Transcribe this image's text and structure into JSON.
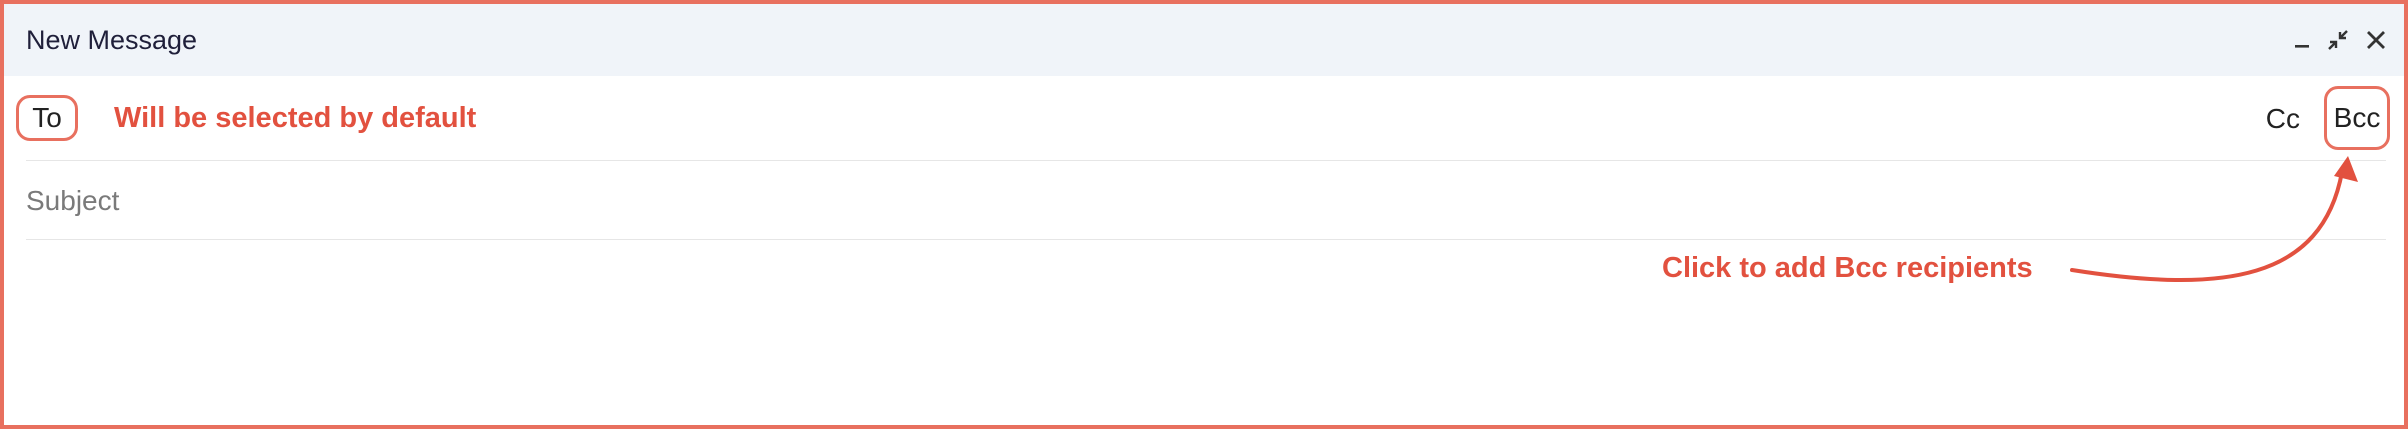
{
  "window": {
    "title": "New Message",
    "controls": [
      "minimize-icon",
      "exit-fullscreen-icon",
      "close-icon"
    ]
  },
  "compose": {
    "to_label": "To",
    "cc_label": "Cc",
    "bcc_label": "Bcc",
    "subject_placeholder": "Subject",
    "subject_value": ""
  },
  "annotations": {
    "to_note": "Will be selected by default",
    "bcc_note": "Click to add Bcc recipients"
  },
  "colors": {
    "annotation": "#e2513f",
    "highlight_border": "#e8705f",
    "titlebar_bg": "#f0f4f9"
  }
}
